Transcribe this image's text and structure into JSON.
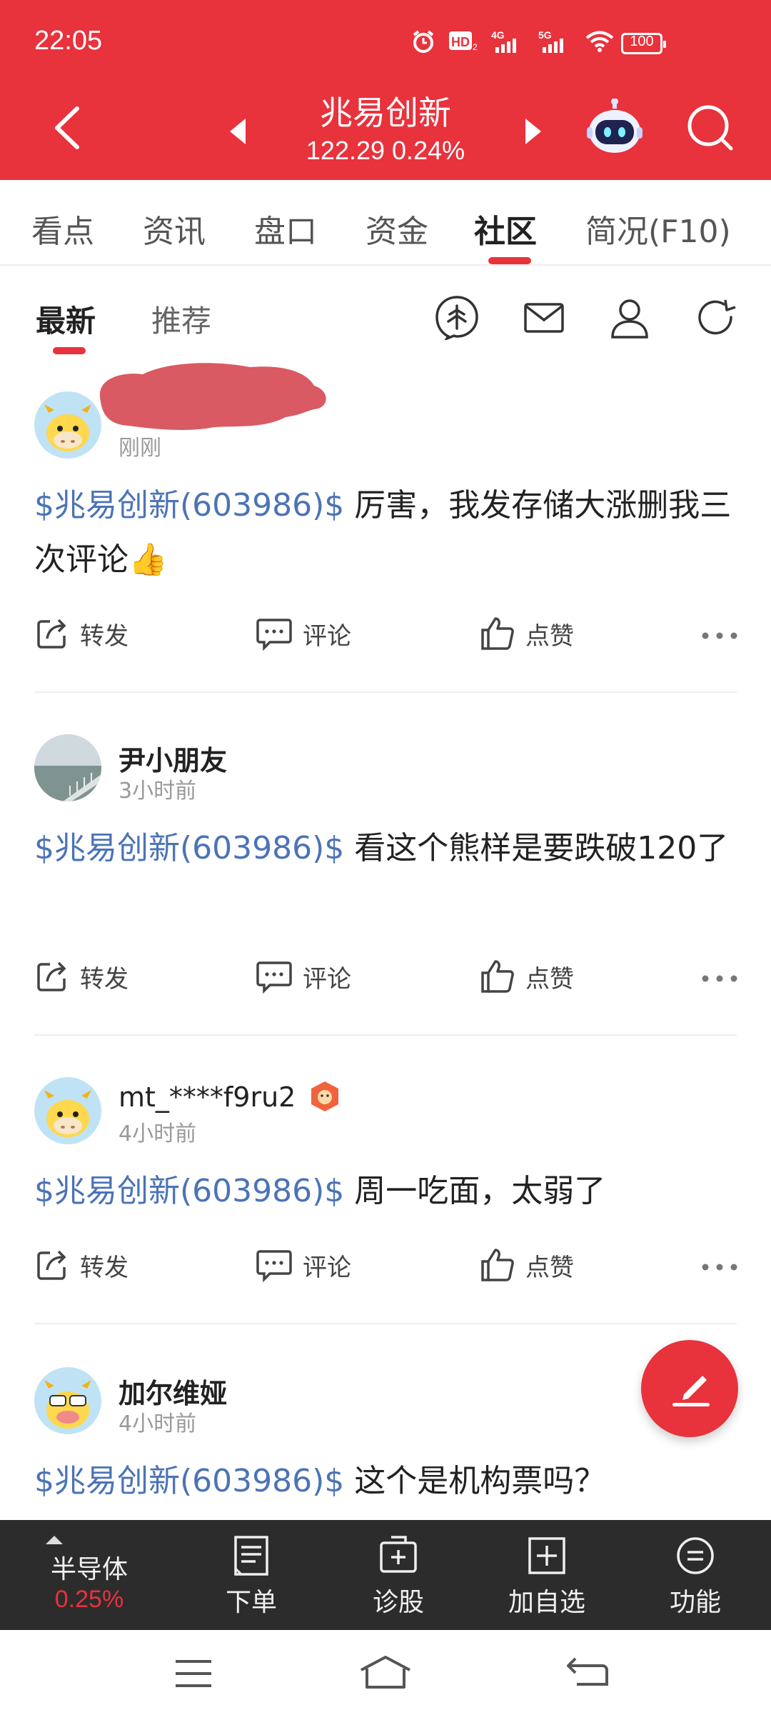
{
  "status_bar": {
    "time": "22:05",
    "battery": "100"
  },
  "header": {
    "title": "兆易创新",
    "price_change": "122.29 0.24%"
  },
  "tabs": [
    "看点",
    "资讯",
    "盘口",
    "资金",
    "社区",
    "简况(F10)"
  ],
  "active_tab": "社区",
  "subtabs": [
    "最新",
    "推荐"
  ],
  "active_subtab": "最新",
  "posts": [
    {
      "username": "",
      "time": "刚刚",
      "stock_tag": "$兆易创新(603986)$",
      "text": " 厉害，我发存储大涨删我三次评论",
      "emoji": "👍"
    },
    {
      "username": "尹小朋友",
      "time": "3小时前",
      "stock_tag": "$兆易创新(603986)$",
      "text": " 看这个熊样是要跌破120了"
    },
    {
      "username": "mt_****f9ru2",
      "time": "4小时前",
      "stock_tag": "$兆易创新(603986)$",
      "text": " 周一吃面，太弱了"
    },
    {
      "username": "加尔维娅",
      "time": "4小时前",
      "stock_tag": "$兆易创新(603986)$",
      "text": " 这个是机构票吗？"
    }
  ],
  "actions": {
    "forward": "转发",
    "comment": "评论",
    "like": "点赞"
  },
  "toolbar": {
    "sector_name": "半导体",
    "sector_change": "0.25%",
    "order": "下单",
    "diagnose": "诊股",
    "add_watch": "加自选",
    "functions": "功能"
  },
  "colors": {
    "brand_red": "#e8323c",
    "link_blue": "#4b73b7",
    "toolbar_bg": "#2c2c2c"
  }
}
